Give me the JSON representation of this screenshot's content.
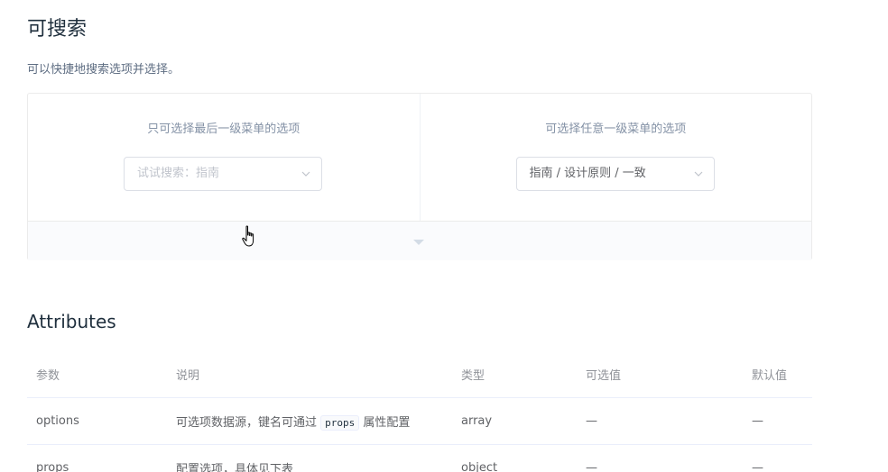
{
  "section": {
    "title": "可搜索",
    "description": "可以快捷地搜索选项并选择。"
  },
  "demo": {
    "left": {
      "label": "只可选择最后一级菜单的选项",
      "placeholder": "试试搜索：指南"
    },
    "right": {
      "label": "可选择任意一级菜单的选项",
      "value": "指南 / 设计原则 / 一致"
    }
  },
  "attributes": {
    "title": "Attributes",
    "columns": [
      "参数",
      "说明",
      "类型",
      "可选值",
      "默认值"
    ],
    "rows": [
      {
        "param": "options",
        "desc_before": "可选项数据源，键名可通过",
        "desc_code": "props",
        "desc_after": "属性配置",
        "type": "array",
        "options": "—",
        "default": "—"
      },
      {
        "param": "props",
        "desc": "配置选项，具体见下表",
        "type": "object",
        "options": "—",
        "default": "—"
      }
    ]
  },
  "icons": {
    "chevron": "chevron-down-icon",
    "expand": "caret-down-icon",
    "cursor": "hand-pointer-icon"
  }
}
